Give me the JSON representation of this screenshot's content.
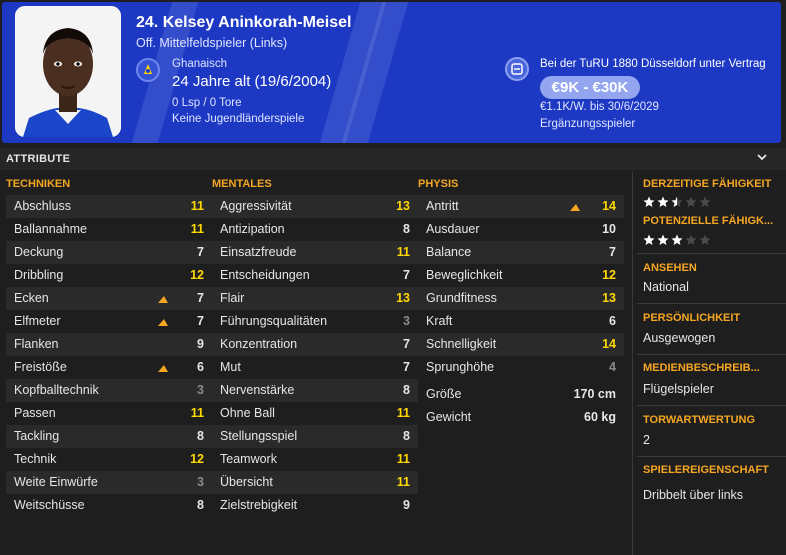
{
  "header": {
    "name": "24. Kelsey Aninkorah-Meisel",
    "position": "Off. Mittelfeldspieler (Links)",
    "nationality": "Ghanaisch",
    "age": "24 Jahre alt (19/6/2004)",
    "apps": "0 Lsp / 0 Tore",
    "youth": "Keine Jugendländerspiele",
    "contract": "Bei der TuRU 1880 Düsseldorf unter Vertrag",
    "value": "€9K - €30K",
    "wage": "€1.1K/W. bis 30/6/2029",
    "squad_status": "Ergänzungsspieler",
    "colors": {
      "header_bg": "#1d39c4",
      "accent": "#f5a623",
      "highlight_value": "#ffd800"
    }
  },
  "section": {
    "title": "ATTRIBUTE"
  },
  "columns": [
    {
      "title": "TECHNIKEN",
      "attributes": [
        {
          "label": "Abschluss",
          "value": "11",
          "color": "yellow"
        },
        {
          "label": "Ballannahme",
          "value": "11",
          "color": "yellow"
        },
        {
          "label": "Deckung",
          "value": "7",
          "color": "white"
        },
        {
          "label": "Dribbling",
          "value": "12",
          "color": "yellow"
        },
        {
          "label": "Ecken",
          "value": "7",
          "color": "white",
          "trend": "up"
        },
        {
          "label": "Elfmeter",
          "value": "7",
          "color": "white",
          "trend": "up"
        },
        {
          "label": "Flanken",
          "value": "9",
          "color": "white"
        },
        {
          "label": "Freistöße",
          "value": "6",
          "color": "white",
          "trend": "up"
        },
        {
          "label": "Kopfballtechnik",
          "value": "3",
          "color": "grey"
        },
        {
          "label": "Passen",
          "value": "11",
          "color": "yellow"
        },
        {
          "label": "Tackling",
          "value": "8",
          "color": "white"
        },
        {
          "label": "Technik",
          "value": "12",
          "color": "yellow"
        },
        {
          "label": "Weite Einwürfe",
          "value": "3",
          "color": "grey"
        },
        {
          "label": "Weitschüsse",
          "value": "8",
          "color": "white"
        }
      ]
    },
    {
      "title": "MENTALES",
      "attributes": [
        {
          "label": "Aggressivität",
          "value": "13",
          "color": "yellow"
        },
        {
          "label": "Antizipation",
          "value": "8",
          "color": "white"
        },
        {
          "label": "Einsatzfreude",
          "value": "11",
          "color": "yellow"
        },
        {
          "label": "Entscheidungen",
          "value": "7",
          "color": "white"
        },
        {
          "label": "Flair",
          "value": "13",
          "color": "yellow"
        },
        {
          "label": "Führungsqualitäten",
          "value": "3",
          "color": "grey"
        },
        {
          "label": "Konzentration",
          "value": "7",
          "color": "white"
        },
        {
          "label": "Mut",
          "value": "7",
          "color": "white"
        },
        {
          "label": "Nervenstärke",
          "value": "8",
          "color": "white"
        },
        {
          "label": "Ohne Ball",
          "value": "11",
          "color": "yellow"
        },
        {
          "label": "Stellungsspiel",
          "value": "8",
          "color": "white"
        },
        {
          "label": "Teamwork",
          "value": "11",
          "color": "yellow"
        },
        {
          "label": "Übersicht",
          "value": "11",
          "color": "yellow"
        },
        {
          "label": "Zielstrebigkeit",
          "value": "9",
          "color": "white"
        }
      ]
    },
    {
      "title": "PHYSIS",
      "attributes": [
        {
          "label": "Antritt",
          "value": "14",
          "color": "yellow",
          "trend": "up"
        },
        {
          "label": "Ausdauer",
          "value": "10",
          "color": "white"
        },
        {
          "label": "Balance",
          "value": "7",
          "color": "white"
        },
        {
          "label": "Beweglichkeit",
          "value": "12",
          "color": "yellow"
        },
        {
          "label": "Grundfitness",
          "value": "13",
          "color": "yellow"
        },
        {
          "label": "Kraft",
          "value": "6",
          "color": "white"
        },
        {
          "label": "Schnelligkeit",
          "value": "14",
          "color": "yellow"
        },
        {
          "label": "Sprunghöhe",
          "value": "4",
          "color": "grey"
        },
        {
          "label": "Größe",
          "value": "170 cm",
          "color": "white"
        },
        {
          "label": "Gewicht",
          "value": "60 kg",
          "color": "white"
        }
      ]
    }
  ],
  "side_panel": {
    "current_ability_label": "DERZEITIGE FÄHIGKEIT",
    "current_ability_stars": 2.5,
    "potential_ability_label": "POTENZIELLE FÄHIGK...",
    "potential_ability_stars": 3,
    "reputation_label": "ANSEHEN",
    "reputation_value": "National",
    "personality_label": "PERSÖNLICHKEIT",
    "personality_value": "Ausgewogen",
    "media_label": "MEDIENBESCHREIB...",
    "media_value": "Flügelspieler",
    "gk_rating_label": "TORWARTWERTUNG",
    "gk_rating_value": "2",
    "traits_label": "SPIELEREIGENSCHAFT",
    "traits_value": "Dribbelt über links"
  }
}
